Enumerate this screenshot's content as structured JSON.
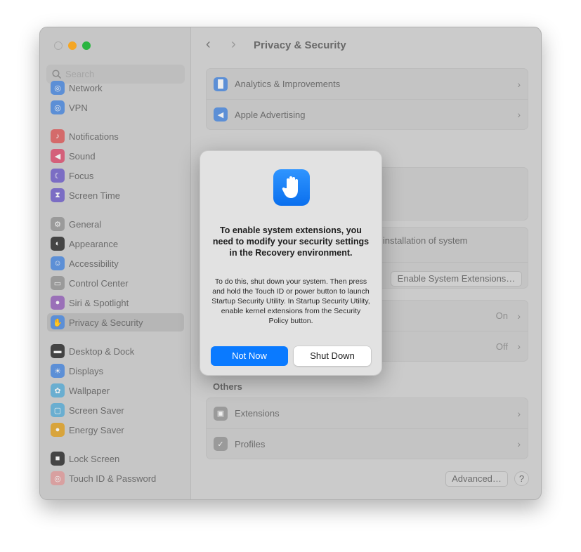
{
  "window": {
    "title": "Privacy & Security"
  },
  "sidebar": {
    "search_placeholder": "Search",
    "items": [
      {
        "label": "Network",
        "icon": "globe-icon",
        "color": "#5c8fd6"
      },
      {
        "label": "VPN",
        "icon": "vpn-globe-icon",
        "color": "#5c8fd6"
      },
      {
        "label": "Notifications",
        "icon": "bell-icon",
        "color": "#d46a6a"
      },
      {
        "label": "Sound",
        "icon": "speaker-icon",
        "color": "#d4607a"
      },
      {
        "label": "Focus",
        "icon": "moon-icon",
        "color": "#7b6dc4"
      },
      {
        "label": "Screen Time",
        "icon": "hourglass-icon",
        "color": "#7b6dc4"
      },
      {
        "label": "General",
        "icon": "gear-icon",
        "color": "#9a9a9a"
      },
      {
        "label": "Appearance",
        "icon": "appearance-icon",
        "color": "#444444"
      },
      {
        "label": "Accessibility",
        "icon": "accessibility-icon",
        "color": "#5c8fd6"
      },
      {
        "label": "Control Center",
        "icon": "toggles-icon",
        "color": "#9a9a9a"
      },
      {
        "label": "Siri & Spotlight",
        "icon": "siri-icon",
        "color": "#9a70b8"
      },
      {
        "label": "Privacy & Security",
        "icon": "hand-icon",
        "color": "#5c8fd6",
        "selected": true
      },
      {
        "label": "Desktop & Dock",
        "icon": "dock-icon",
        "color": "#444444"
      },
      {
        "label": "Displays",
        "icon": "sun-icon",
        "color": "#5c8fd6"
      },
      {
        "label": "Wallpaper",
        "icon": "flower-icon",
        "color": "#6aaed0"
      },
      {
        "label": "Screen Saver",
        "icon": "screensaver-icon",
        "color": "#6aaed0"
      },
      {
        "label": "Energy Saver",
        "icon": "bulb-icon",
        "color": "#d8a43c"
      },
      {
        "label": "Lock Screen",
        "icon": "lock-icon",
        "color": "#444444"
      },
      {
        "label": "Touch ID & Password",
        "icon": "fingerprint-icon",
        "color": "#d8a0a0"
      }
    ]
  },
  "main": {
    "card1": [
      {
        "label": "Analytics & Improvements",
        "icon": "chart-icon"
      },
      {
        "label": "Apple Advertising",
        "icon": "megaphone-icon"
      }
    ],
    "card3": {
      "text": "e installation of system",
      "button": "Enable System Extensions…"
    },
    "card4": [
      {
        "value": "On"
      },
      {
        "value": "Off"
      }
    ],
    "others_heading": "Others",
    "card5": [
      {
        "label": "Extensions",
        "icon": "extensions-icon"
      },
      {
        "label": "Profiles",
        "icon": "checkmark-shield-icon"
      }
    ],
    "advanced_button": "Advanced…",
    "help_button": "?"
  },
  "dialog": {
    "icon": "hand-raised-icon",
    "heading": "To enable system extensions, you need to modify your security settings in the Recovery environment.",
    "body": "To do this, shut down your system. Then press and hold the Touch ID or power button to launch Startup Security Utility. In Startup Security Utility, enable kernel extensions from the Security Policy button.",
    "primary": "Not Now",
    "secondary": "Shut Down",
    "accent": "#0a7aff"
  }
}
